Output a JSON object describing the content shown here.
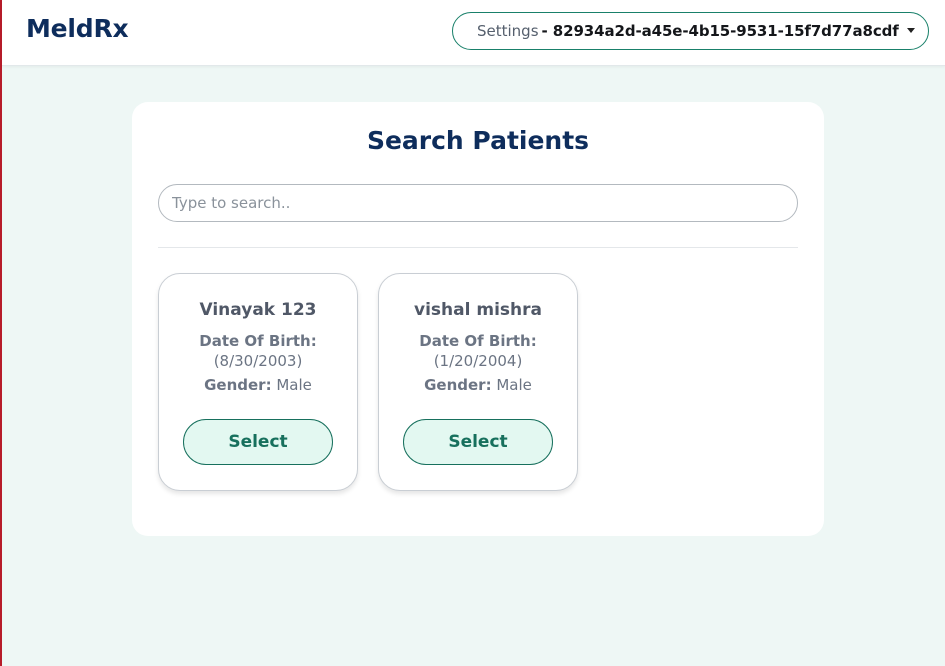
{
  "header": {
    "brand": "MeldRx",
    "settings_label": "Settings",
    "settings_id": "- 82934a2d-a45e-4b15-9531-15f7d77a8cdf"
  },
  "main": {
    "title": "Search Patients",
    "search": {
      "placeholder": "Type to search..",
      "value": ""
    },
    "patients": [
      {
        "name": "Vinayak 123",
        "dob_label": "Date Of Birth:",
        "dob": "(8/30/2003)",
        "gender_label": "Gender:",
        "gender": " Male",
        "select_label": "Select"
      },
      {
        "name": "vishal mishra",
        "dob_label": "Date Of Birth:",
        "dob": "(1/20/2004)",
        "gender_label": "Gender:",
        "gender": " Male",
        "select_label": "Select"
      }
    ]
  },
  "colors": {
    "brand": "#0e2d5c",
    "accent": "#17705d",
    "button_bg": "#e3f8f1",
    "page_bg": "#eef7f5"
  },
  "icons": {
    "settings_dropdown": "caret-down-icon"
  }
}
